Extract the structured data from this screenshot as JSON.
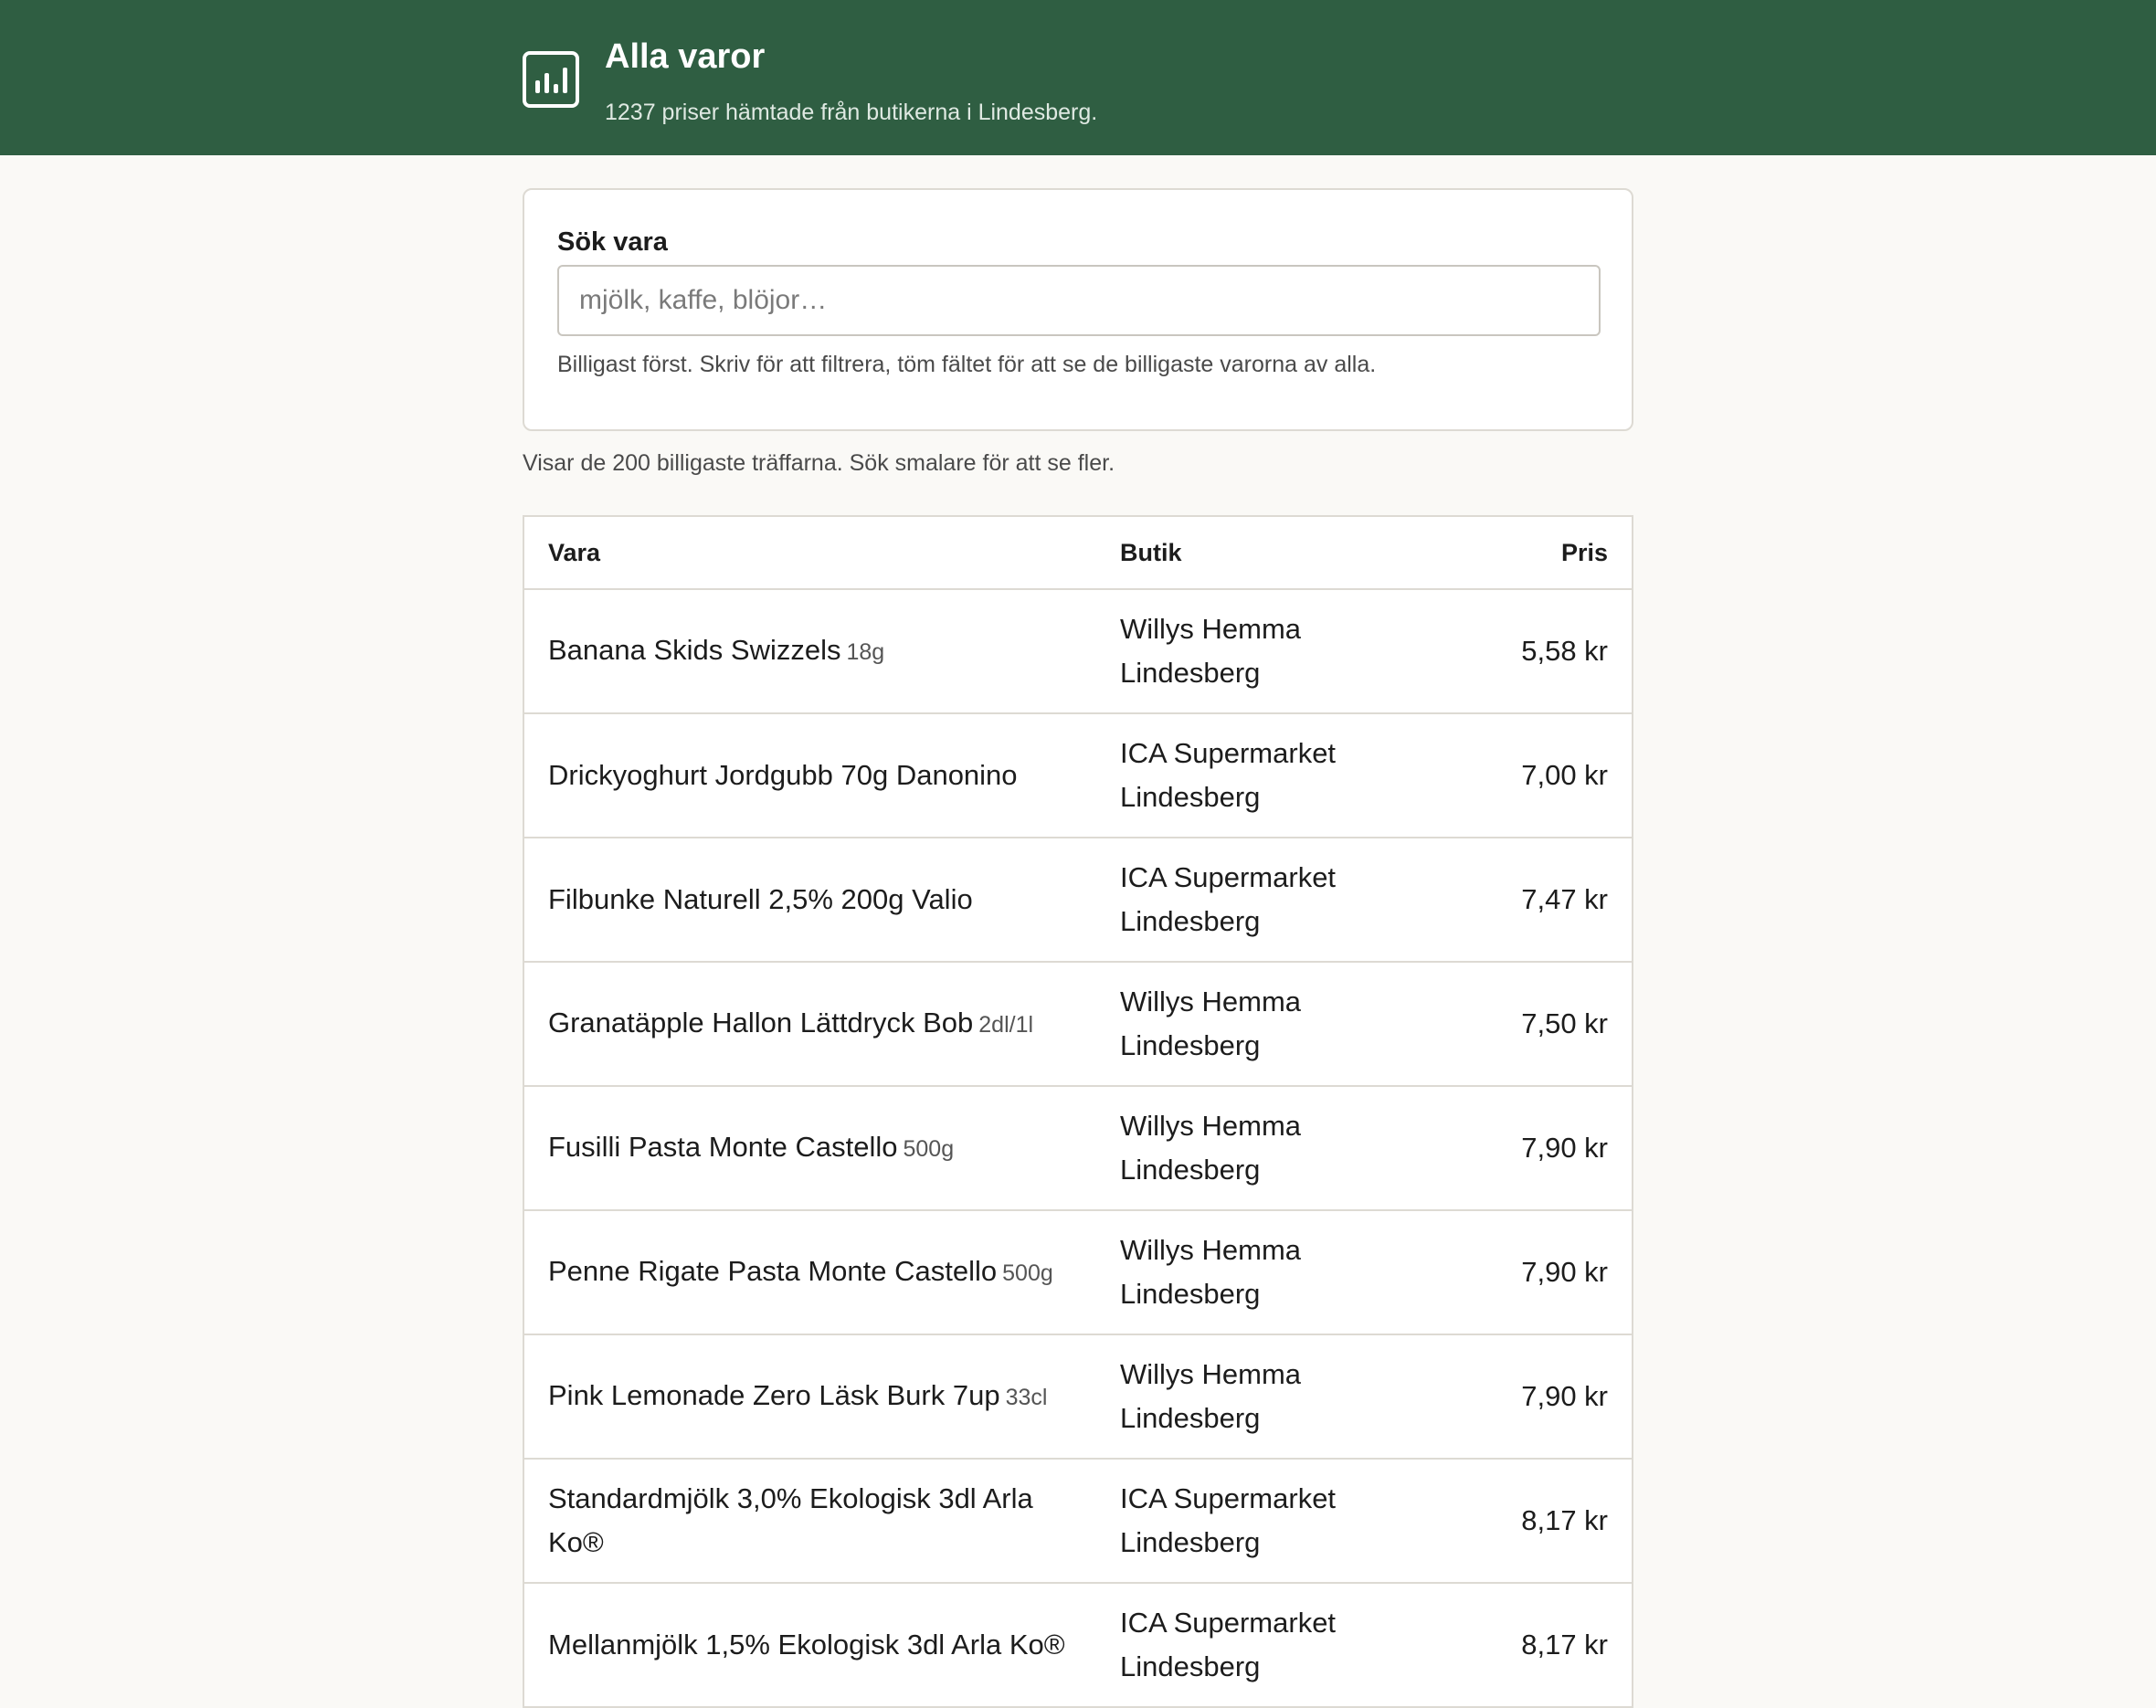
{
  "header": {
    "title": "Alla varor",
    "subtitle": "1237 priser hämtade från butikerna i Lindesberg.",
    "logo_icon": "bar-chart-icon"
  },
  "search": {
    "label": "Sök vara",
    "value": "",
    "placeholder": "mjölk, kaffe, blöjor…",
    "hint": "Billigast först. Skriv för att filtrera, töm fältet för att se de billigaste varorna av alla."
  },
  "results": {
    "info": "Visar de 200 billigaste träffarna. Sök smalare för att se fler."
  },
  "table": {
    "columns": {
      "vara": "Vara",
      "butik": "Butik",
      "pris": "Pris"
    },
    "rows": [
      {
        "name": "Banana Skids Swizzels",
        "unit": "18g",
        "store": "Willys Hemma Lindesberg",
        "price": "5,58 kr"
      },
      {
        "name": "Drickyoghurt Jordgubb 70g Danonino",
        "unit": "",
        "store": "ICA Supermarket Lindesberg",
        "price": "7,00 kr"
      },
      {
        "name": "Filbunke Naturell 2,5% 200g Valio",
        "unit": "",
        "store": "ICA Supermarket Lindesberg",
        "price": "7,47 kr"
      },
      {
        "name": "Granatäpple Hallon Lättdryck Bob",
        "unit": "2dl/1l",
        "store": "Willys Hemma Lindesberg",
        "price": "7,50 kr"
      },
      {
        "name": "Fusilli Pasta Monte Castello",
        "unit": "500g",
        "store": "Willys Hemma Lindesberg",
        "price": "7,90 kr"
      },
      {
        "name": "Penne Rigate Pasta Monte Castello",
        "unit": "500g",
        "store": "Willys Hemma Lindesberg",
        "price": "7,90 kr"
      },
      {
        "name": "Pink Lemonade Zero Läsk Burk 7up",
        "unit": "33cl",
        "store": "Willys Hemma Lindesberg",
        "price": "7,90 kr"
      },
      {
        "name": "Standardmjölk 3,0% Ekologisk 3dl Arla Ko®",
        "unit": "",
        "store": "ICA Supermarket Lindesberg",
        "price": "8,17 kr"
      },
      {
        "name": "Mellanmjölk 1,5% Ekologisk 3dl Arla Ko®",
        "unit": "",
        "store": "ICA Supermarket Lindesberg",
        "price": "8,17 kr"
      }
    ]
  }
}
